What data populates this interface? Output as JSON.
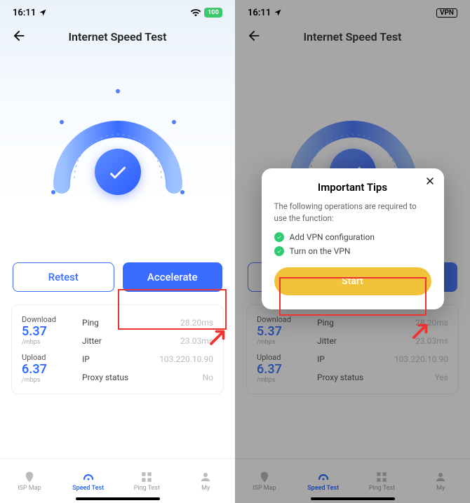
{
  "statusbar": {
    "time": "16:11",
    "battery_pct": "100",
    "vpn_label": "VPN"
  },
  "header": {
    "title": "Internet Speed Test"
  },
  "buttons": {
    "retest": "Retest",
    "accelerate": "Accelerate"
  },
  "stats": {
    "download_label": "Download",
    "download_value": "5.37",
    "download_unit": "/mbps",
    "upload_label": "Upload",
    "upload_value": "6.37",
    "upload_unit": "/mbps",
    "ping_label": "Ping",
    "ping_value": "28.20ms",
    "jitter_label": "Jitter",
    "jitter_value": "23.03ms",
    "ip_label": "IP",
    "ip_value": "103.220.10.90",
    "proxy_label": "Proxy status",
    "proxy_value_left": "No",
    "proxy_value_right": "Yes"
  },
  "tabs": {
    "isp": "ISP Map",
    "speed": "Speed Test",
    "ping": "Ping Test",
    "my": "My"
  },
  "modal": {
    "title": "Important Tips",
    "desc": "The following operations are required to use the function:",
    "item1": "Add VPN configuration",
    "item2": "Turn on the VPN",
    "start": "Start"
  }
}
